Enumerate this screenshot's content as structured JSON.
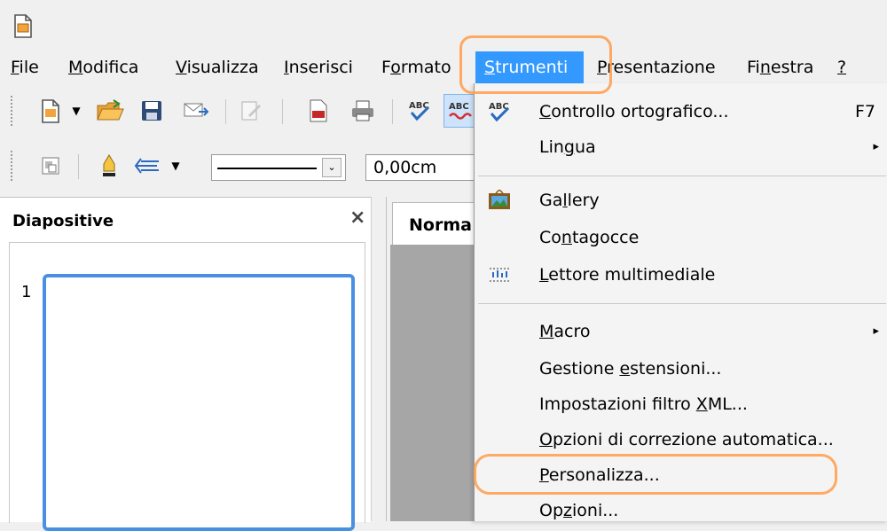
{
  "menubar": {
    "items": [
      {
        "label": "File",
        "u": "F",
        "rest": "ile"
      },
      {
        "label": "Modifica",
        "u": "M",
        "rest": "odifica"
      },
      {
        "label": "Visualizza",
        "u": "V",
        "rest": "isualizza"
      },
      {
        "label": "Inserisci",
        "u": "I",
        "rest": "nserisci"
      },
      {
        "label": "Formato",
        "pre": "F",
        "u": "o",
        "rest": "rmato"
      },
      {
        "label": "Strumenti",
        "u": "S",
        "rest": "trumenti"
      },
      {
        "label": "Presentazione",
        "u": "P",
        "rest": "resentazione"
      },
      {
        "label": "Finestra",
        "pre": "Fi",
        "u": "n",
        "rest": "estra"
      },
      {
        "label": "?",
        "u": "?",
        "rest": ""
      }
    ]
  },
  "toolbar2": {
    "line_style": "",
    "width_value": "0,00cm"
  },
  "slides_panel": {
    "title": "Diapositive",
    "close": "×",
    "slide_number": "1"
  },
  "main": {
    "tab_label": "Norma"
  },
  "tools_menu": {
    "items": [
      {
        "pre": "",
        "u": "C",
        "rest": "ontrollo ortografico...",
        "shortcut": "F7",
        "icon": "spellcheck-icon"
      },
      {
        "pre": "Lin",
        "u": "g",
        "rest": "ua",
        "submenu": true
      },
      {
        "pre": "Ga",
        "u": "l",
        "rest": "lery",
        "icon": "gallery-icon"
      },
      {
        "pre": "Co",
        "u": "n",
        "rest": "tagocce"
      },
      {
        "pre": "",
        "u": "L",
        "rest": "ettore multimediale",
        "icon": "media-player-icon"
      },
      {
        "pre": "",
        "u": "M",
        "rest": "acro",
        "submenu": true
      },
      {
        "pre": "Gestione ",
        "u": "e",
        "rest": "stensioni..."
      },
      {
        "pre": "Impostazioni filtro ",
        "u": "X",
        "rest": "ML..."
      },
      {
        "pre": "",
        "u": "O",
        "rest": "pzioni di correzione automatica..."
      },
      {
        "pre": "",
        "u": "P",
        "rest": "ersonalizza..."
      },
      {
        "pre": "Op",
        "u": "z",
        "rest": "ioni..."
      }
    ]
  },
  "colors": {
    "menu_highlight": "#3399ff",
    "annotation": "#ff9b4a",
    "slide_border": "#4a90e2"
  }
}
